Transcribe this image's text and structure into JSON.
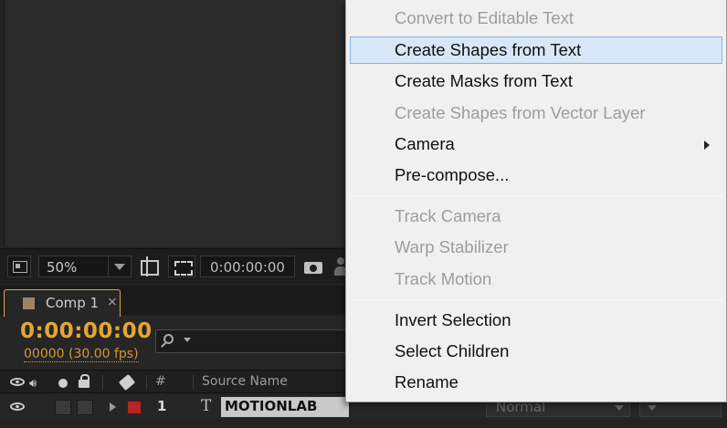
{
  "viewer": {
    "zoom": "50%",
    "timecode": "0:00:00:00"
  },
  "timeline": {
    "tab_label": "Comp 1",
    "tab_close": "×",
    "current_time": "0:00:00:00",
    "frame_info": "00000 (30.00 fps)",
    "columns": {
      "number": "#",
      "source_name": "Source Name"
    },
    "layer": {
      "number": "1",
      "type_glyph": "T",
      "name": "MOTIONLAB",
      "mode": "Normal",
      "label_color": "#b42525"
    }
  },
  "context_menu": {
    "items": [
      {
        "label": "Convert to Editable Text",
        "enabled": false
      },
      {
        "label": "Create Shapes from Text",
        "enabled": true,
        "highlighted": true
      },
      {
        "label": "Create Masks from Text",
        "enabled": true
      },
      {
        "label": "Create Shapes from Vector Layer",
        "enabled": false
      },
      {
        "label": "Camera",
        "enabled": true,
        "submenu": true
      },
      {
        "label": "Pre-compose...",
        "enabled": true
      },
      {
        "label": "Track Camera",
        "enabled": false
      },
      {
        "label": "Warp Stabilizer",
        "enabled": false
      },
      {
        "label": "Track Motion",
        "enabled": false
      },
      {
        "label": "Invert Selection",
        "enabled": true
      },
      {
        "label": "Select Children",
        "enabled": true
      },
      {
        "label": "Rename",
        "enabled": true
      }
    ]
  },
  "colors": {
    "timecode_accent": "#e3a634",
    "menu_highlight": "#d6e7f7",
    "panel_background": "#232323"
  }
}
